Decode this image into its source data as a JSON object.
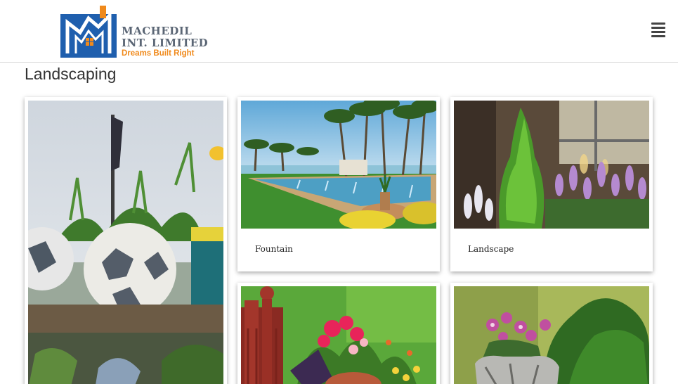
{
  "header": {
    "logo": {
      "line1": "MACHEDIL",
      "line2": "INT. LIMITED",
      "tagline": "Dreams Built Right",
      "brand_blue": "#1f5fae",
      "brand_orange": "#f08a1c"
    },
    "menu_icon": "hamburger-icon"
  },
  "page": {
    "title": "Landscaping"
  },
  "gallery": {
    "items": [
      {
        "caption": "",
        "image": "soccer-ball-planter-photo"
      },
      {
        "caption": "Fountain",
        "image": "fountain-photo"
      },
      {
        "caption": "Landscape",
        "image": "landscape-plants-photo"
      },
      {
        "caption": "",
        "image": "flower-pot-railing-photo"
      },
      {
        "caption": "",
        "image": "purple-flowers-planter-photo"
      }
    ]
  }
}
